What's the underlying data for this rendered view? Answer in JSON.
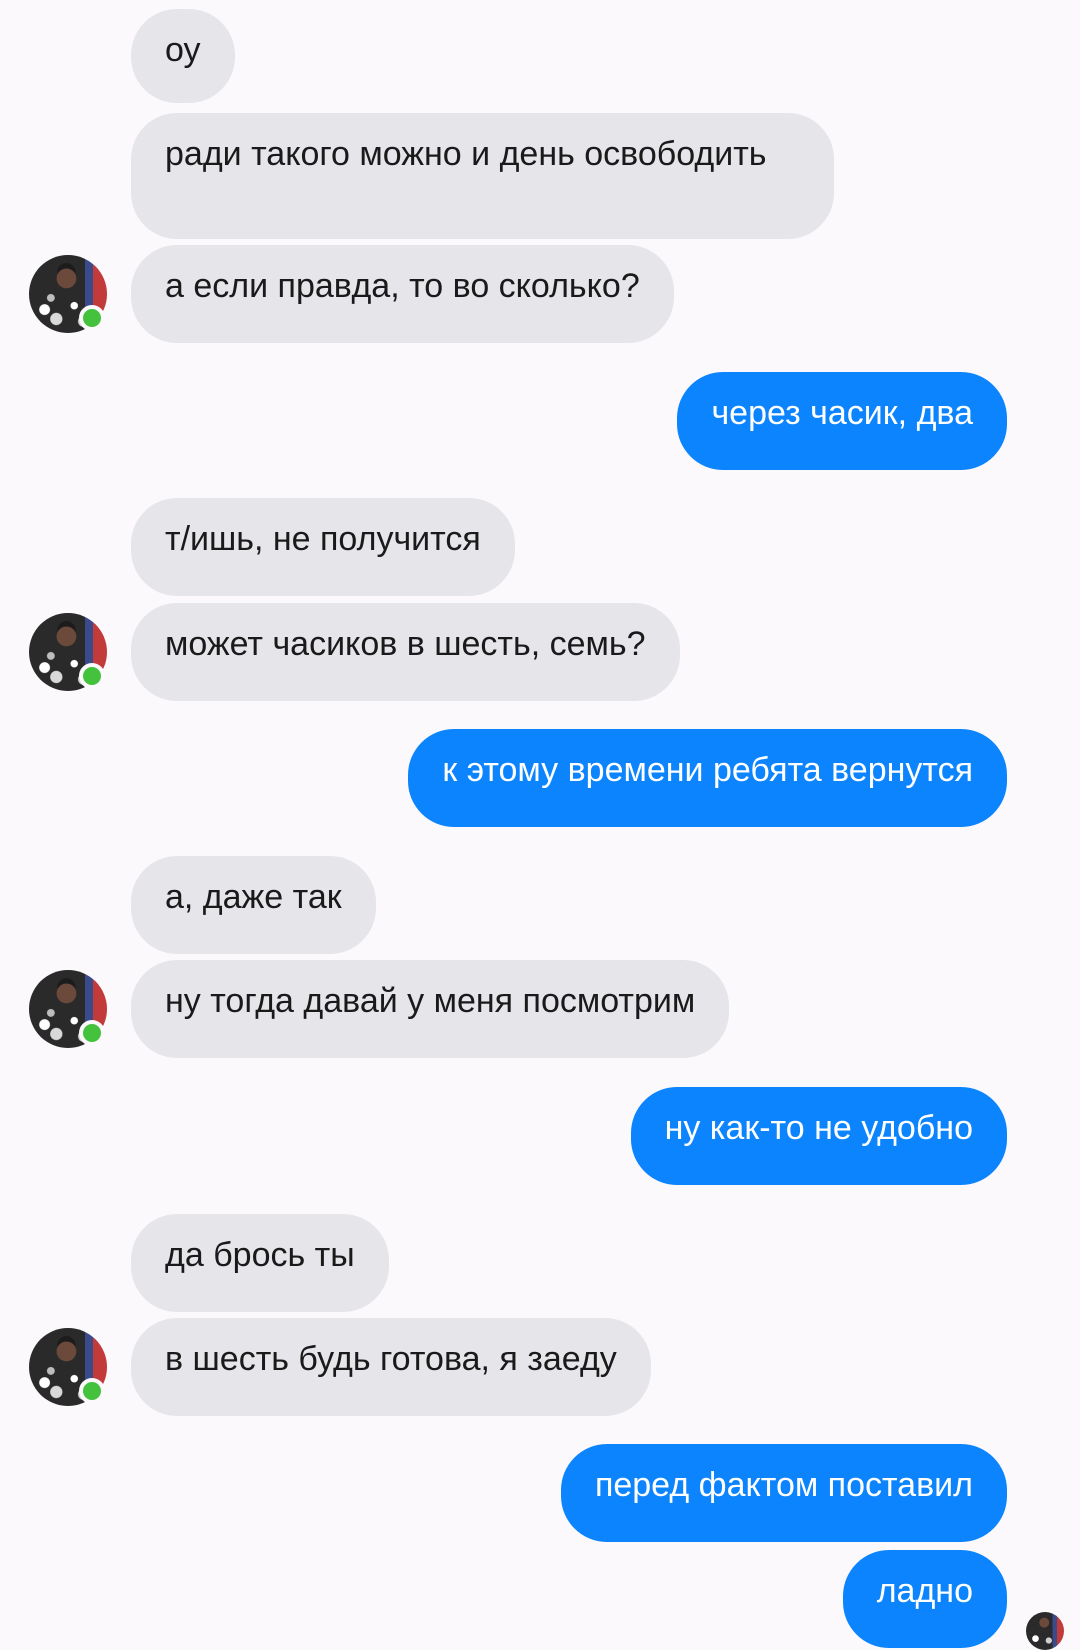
{
  "messages": [
    {
      "from": "them",
      "text": "оу"
    },
    {
      "from": "them",
      "text": "ради такого можно и день освободить"
    },
    {
      "from": "them",
      "text": "а если правда, то во сколько?"
    },
    {
      "from": "me",
      "text": "через часик, два"
    },
    {
      "from": "them",
      "text": "т/ишь, не получится"
    },
    {
      "from": "them",
      "text": "может часиков в шесть, семь?"
    },
    {
      "from": "me",
      "text": "к этому времени ребята вернутся"
    },
    {
      "from": "them",
      "text": "а, даже так"
    },
    {
      "from": "them",
      "text": "ну тогда давай у меня посмотрим"
    },
    {
      "from": "me",
      "text": "ну как-то не удобно"
    },
    {
      "from": "them",
      "text": "да брось ты"
    },
    {
      "from": "them",
      "text": "в шесть будь готова, я заеду"
    },
    {
      "from": "me",
      "text": "перед фактом поставил"
    },
    {
      "from": "me",
      "text": "ладно"
    }
  ],
  "contact": {
    "avatar_icon": "user-avatar-icon",
    "online_status": "online",
    "online_color": "#44c23d"
  },
  "colors": {
    "incoming_bubble": "#e6e5ea",
    "outgoing_bubble": "#0b84fe",
    "background": "#fbf9fc"
  }
}
